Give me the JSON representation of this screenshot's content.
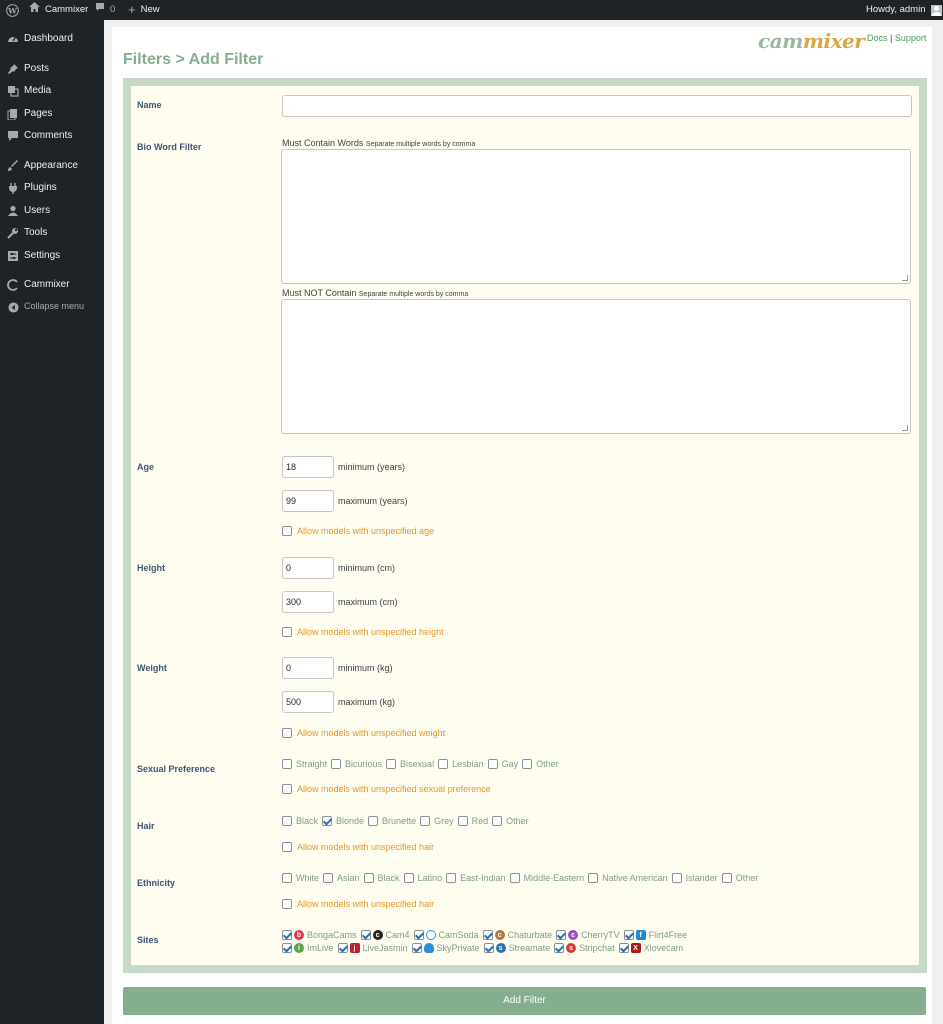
{
  "adminbar": {
    "site_name": "Cammixer",
    "comments_count": "0",
    "new_label": "New",
    "greeting": "Howdy, admin"
  },
  "menu": {
    "items": [
      {
        "label": "Dashboard",
        "icon": "dashboard-icon"
      },
      {
        "label": "Posts",
        "icon": "pin-icon"
      },
      {
        "label": "Media",
        "icon": "media-icon"
      },
      {
        "label": "Pages",
        "icon": "pages-icon"
      },
      {
        "label": "Comments",
        "icon": "comment-icon"
      },
      {
        "label": "Appearance",
        "icon": "brush-icon"
      },
      {
        "label": "Plugins",
        "icon": "plugin-icon"
      },
      {
        "label": "Users",
        "icon": "user-icon"
      },
      {
        "label": "Tools",
        "icon": "wrench-icon"
      },
      {
        "label": "Settings",
        "icon": "settings-icon"
      },
      {
        "label": "Cammixer",
        "icon": "cammixer-icon"
      },
      {
        "label": "Collapse menu",
        "icon": "collapse-icon"
      }
    ]
  },
  "header": {
    "title": "Filters > Add Filter",
    "logo_cam": "cam",
    "logo_mixer": "mixer",
    "docs": "Docs",
    "sep": "|",
    "support": "Support"
  },
  "form": {
    "name_label": "Name",
    "name_value": "",
    "bio_label": "Bio Word Filter",
    "must_contain": "Must Contain Words",
    "must_contain_hint": "Separate multiple words by comma",
    "must_not_contain": "Must NOT Contain",
    "must_not_hint": "Separate multiple words by comma",
    "age": {
      "label": "Age",
      "min": "18",
      "min_label": "minimum (years)",
      "max": "99",
      "max_label": "maximum (years)",
      "allow": "Allow models with unspecified age"
    },
    "height": {
      "label": "Height",
      "min": "0",
      "min_label": "minimum (cm)",
      "max": "300",
      "max_label": "maximum (cm)",
      "allow": "Allow models with unspecified height"
    },
    "weight": {
      "label": "Weight",
      "min": "0",
      "min_label": "minimum (kg)",
      "max": "500",
      "max_label": "maximum (kg)",
      "allow": "Allow models with unspecified weight"
    },
    "sexual_pref": {
      "label": "Sexual Preference",
      "options": [
        {
          "label": "Straight",
          "checked": false
        },
        {
          "label": "Bicurious",
          "checked": false
        },
        {
          "label": "Bisexual",
          "checked": false
        },
        {
          "label": "Lesbian",
          "checked": false
        },
        {
          "label": "Gay",
          "checked": false
        },
        {
          "label": "Other",
          "checked": false
        }
      ],
      "allow": "Allow models with unspecified sexual preference"
    },
    "hair": {
      "label": "Hair",
      "options": [
        {
          "label": "Black",
          "checked": false
        },
        {
          "label": "Blonde",
          "checked": true
        },
        {
          "label": "Brunette",
          "checked": false
        },
        {
          "label": "Grey",
          "checked": false
        },
        {
          "label": "Red",
          "checked": false
        },
        {
          "label": "Other",
          "checked": false
        }
      ],
      "allow": "Allow models with unspecified hair"
    },
    "ethnicity": {
      "label": "Ethnicity",
      "options": [
        {
          "label": "White",
          "checked": false
        },
        {
          "label": "Asian",
          "checked": false
        },
        {
          "label": "Black",
          "checked": false
        },
        {
          "label": "Latino",
          "checked": false
        },
        {
          "label": "East-Indian",
          "checked": false
        },
        {
          "label": "Middle-Eastern",
          "checked": false
        },
        {
          "label": "Native American",
          "checked": false
        },
        {
          "label": "Islander",
          "checked": false
        },
        {
          "label": "Other",
          "checked": false
        }
      ],
      "allow": "Allow models with unspecified hair"
    },
    "sites": {
      "label": "Sites",
      "row1": [
        {
          "label": "BongaCams",
          "checked": true,
          "color": "#e8344e",
          "glyph": "b"
        },
        {
          "label": "Cam4",
          "checked": true,
          "color": "#222222",
          "glyph": "c"
        },
        {
          "label": "CamSoda",
          "checked": true,
          "color": "#1e9ae0",
          "glyph": "o"
        },
        {
          "label": "Chaturbate",
          "checked": true,
          "color": "#b07a3c",
          "glyph": "c"
        },
        {
          "label": "CherryTV",
          "checked": true,
          "color": "#9b4fc4",
          "glyph": "c"
        },
        {
          "label": "Flirt4Free",
          "checked": true,
          "color": "#1e88d6",
          "glyph": "f"
        }
      ],
      "row2": [
        {
          "label": "ImLive",
          "checked": true,
          "color": "#5aa24a",
          "glyph": "i"
        },
        {
          "label": "LiveJasmin",
          "checked": true,
          "color": "#c0202a",
          "glyph": "j"
        },
        {
          "label": "SkyPrivate",
          "checked": true,
          "color": "#2b8fd8",
          "glyph": "s"
        },
        {
          "label": "Streamate",
          "checked": true,
          "color": "#2c6fb0",
          "glyph": "s"
        },
        {
          "label": "Stripchat",
          "checked": true,
          "color": "#d83a3a",
          "glyph": "s"
        },
        {
          "label": "Xlovecam",
          "checked": true,
          "color": "#b01818",
          "glyph": "X"
        }
      ]
    },
    "submit": "Add Filter"
  },
  "colors": {
    "accent": "#84ae8e",
    "panel_bg": "#fffdf0",
    "frame": "#c6d8c6",
    "allow_text": "#e2972a"
  }
}
